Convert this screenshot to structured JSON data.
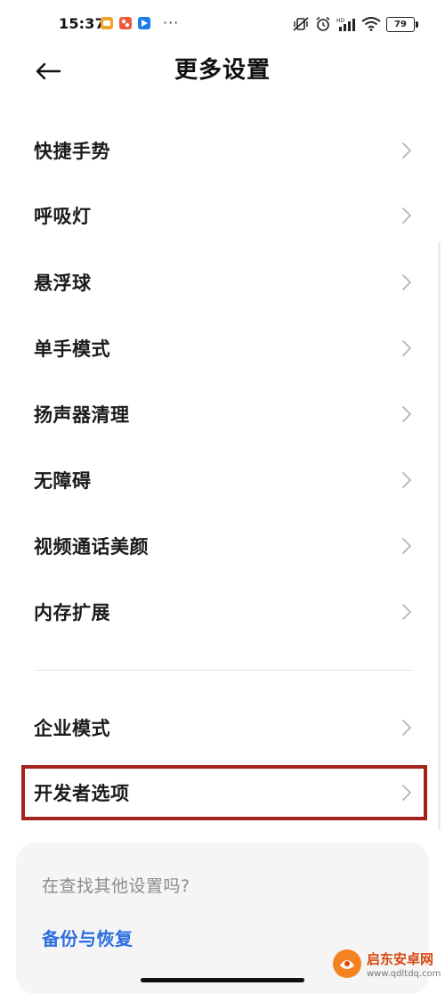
{
  "status_bar": {
    "time": "15:37",
    "more": "···",
    "battery": "79"
  },
  "header": {
    "title": "更多设置",
    "back_icon": "back-arrow-icon"
  },
  "settings": {
    "items": [
      {
        "label": "快捷手势"
      },
      {
        "label": "呼吸灯"
      },
      {
        "label": "悬浮球"
      },
      {
        "label": "单手模式"
      },
      {
        "label": "扬声器清理"
      },
      {
        "label": "无障碍"
      },
      {
        "label": "视频通话美颜"
      },
      {
        "label": "内存扩展"
      },
      {
        "label": "企业模式"
      },
      {
        "label": "开发者选项",
        "highlighted": true
      }
    ]
  },
  "search_card": {
    "hint": "在查找其他设置吗?",
    "link": "备份与恢复"
  },
  "watermark": {
    "title": "启东安卓网",
    "url": "www.qdltdq.com"
  },
  "colors": {
    "highlight_border": "#a3221c",
    "link": "#2d6fe0",
    "hint": "#8c8c8c",
    "card_bg": "#f5f5f5"
  }
}
